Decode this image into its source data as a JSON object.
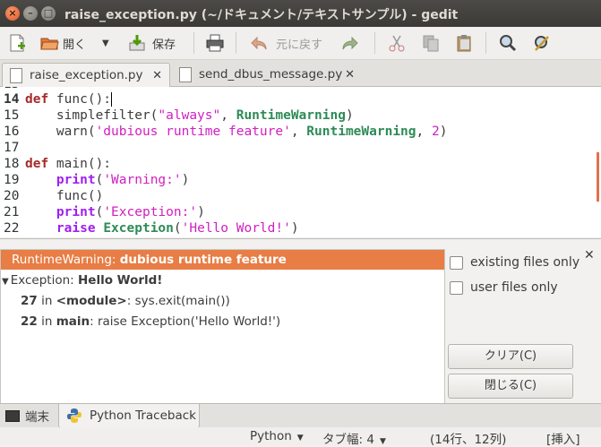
{
  "window": {
    "title": "raise_exception.py (~/ドキュメント/テキストサンプル) - gedit"
  },
  "toolbar": {
    "open_label": "開く",
    "save_label": "保存",
    "undo_label": "元に戻す"
  },
  "tabs": [
    {
      "label": "raise_exception.py"
    },
    {
      "label": "send_dbus_message.py"
    }
  ],
  "editor": {
    "lines": [
      {
        "num": "14"
      },
      {
        "num": "15"
      },
      {
        "num": "16"
      },
      {
        "num": "17"
      },
      {
        "num": "18"
      },
      {
        "num": "19"
      },
      {
        "num": "20"
      },
      {
        "num": "21"
      },
      {
        "num": "22"
      }
    ],
    "tokens": {
      "l14_kw": "def",
      "l14_rest": " func():",
      "l15_a": "    simplefilter(",
      "l15_str": "\"always\"",
      "l15_b": ", ",
      "l15_cls": "RuntimeWarning",
      "l15_c": ")",
      "l16_a": "    warn(",
      "l16_str": "'dubious runtime feature'",
      "l16_b": ", ",
      "l16_cls": "RuntimeWarning",
      "l16_c": ", ",
      "l16_num": "2",
      "l16_d": ")",
      "l18_kw": "def",
      "l18_rest": " main():",
      "l19_a": "    ",
      "l19_bi": "print",
      "l19_b": "(",
      "l19_str": "'Warning:'",
      "l19_c": ")",
      "l20_a": "    func()",
      "l21_a": "    ",
      "l21_bi": "print",
      "l21_b": "(",
      "l21_str": "'Exception:'",
      "l21_c": ")",
      "l22_a": "    ",
      "l22_kw": "raise",
      "l22_sp": " ",
      "l22_cls": "Exception",
      "l22_b": "(",
      "l22_str": "'Hello World!'",
      "l22_c": ")"
    }
  },
  "traceback": {
    "warning_type": "RuntimeWarning: ",
    "warning_msg": "dubious runtime feature",
    "exception_type": "Exception: ",
    "exception_msg": "Hello World!",
    "frames": [
      {
        "line": "27",
        "in": " in ",
        "where": "<module>",
        "sep": ": ",
        "code": "sys.exit(main())"
      },
      {
        "line": "22",
        "in": " in ",
        "where": "main",
        "sep": ": ",
        "code": "raise Exception('Hello World!')"
      }
    ],
    "filter_existing": "existing files only",
    "filter_user": "user files only",
    "clear_button": "クリア(C)",
    "close_button": "閉じる(C)"
  },
  "bottom_tabs": [
    {
      "label": "端末"
    },
    {
      "label": "Python Traceback"
    }
  ],
  "statusbar": {
    "language": "Python",
    "tab_width": "タブ幅: 4",
    "position": "(14行、12列)",
    "mode": "[挿入]"
  },
  "colors": {
    "accent": "#e87d45",
    "titlebar": "#3b3a36"
  }
}
